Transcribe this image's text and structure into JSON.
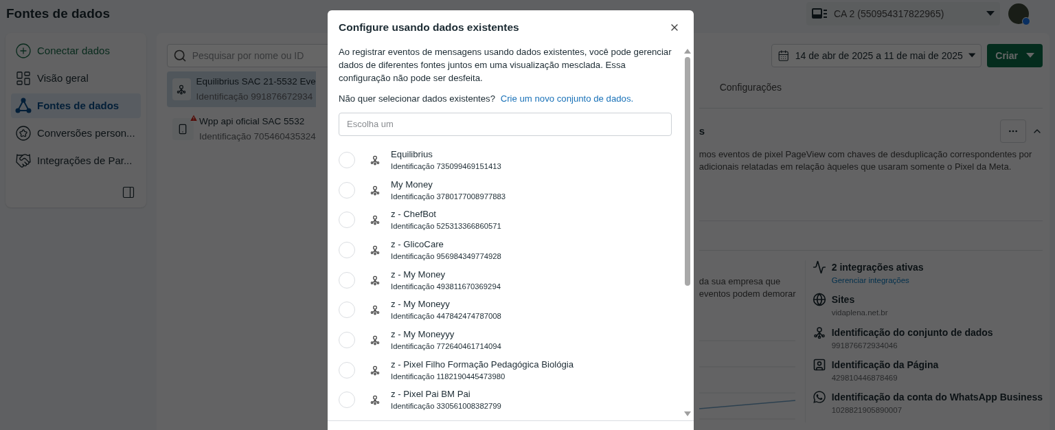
{
  "page": {
    "title": "Fontes de dados"
  },
  "account": {
    "name": "CA 2 (550954317822965)"
  },
  "sidebar": {
    "items": [
      {
        "label": "Conectar dados",
        "kind": "connect",
        "selected": false
      },
      {
        "label": "Visão geral",
        "kind": "overview",
        "selected": false
      },
      {
        "label": "Fontes de dados",
        "kind": "sources",
        "selected": true
      },
      {
        "label": "Conversões person...",
        "kind": "conversions",
        "selected": false
      },
      {
        "label": "Integrações de Par...",
        "kind": "partners",
        "selected": false
      }
    ]
  },
  "sources": {
    "search": {
      "placeholder": "Pesquisar por nome ou ID"
    },
    "items": [
      {
        "name": "Equilibrius SAC 21-5532 Eve",
        "id": "Identificação 991876672934",
        "kind": "dataset",
        "warning": false,
        "selected": true
      },
      {
        "name": "Wpp api oficial SAC 5532",
        "id": "Identificação 705460435324",
        "kind": "phone",
        "warning": true,
        "selected": false
      }
    ]
  },
  "toolbar": {
    "date_range": "14 de abr de 2025 a 11 de mai de 2025",
    "create_button": "Criar"
  },
  "tabs": [
    {
      "label": "Configurações",
      "selected": false
    }
  ],
  "card": {
    "title": "s",
    "description": [
      "mos eventos de pixel PageView com chaves de desduplicação correspondentes por",
      "adicionais relatadas em relação àqueles que usaram somente o Pixel da Meta."
    ]
  },
  "overview": {
    "text": [
      "da sua empresa que",
      "eventos podem demorar"
    ]
  },
  "details": [
    {
      "kind": "activity",
      "title": "2 integrações ativas",
      "value": "Gerenciar integrações",
      "link": true
    },
    {
      "kind": "globe",
      "title": "Sites",
      "value": "vidaplena.net.br",
      "link": false
    },
    {
      "kind": "dataset",
      "title": "Identificação do conjunto de dados",
      "value": "991876672934046",
      "link": false
    },
    {
      "kind": "page",
      "title": "Identificação da Página",
      "value": "429810446878469",
      "link": false
    },
    {
      "kind": "whatsapp",
      "title": "Identificação da conta do WhatsApp Business",
      "value": "1028821905890007",
      "link": false
    }
  ],
  "dialog": {
    "title": "Configure usando dados existentes",
    "description": "Ao registrar eventos de mensagens usando dados existentes, você pode gerenciar dados de diferentes fontes juntos em uma visualização mesclada. Essa configuração não pode ser desfeita.",
    "prompt": "Não quer selecionar dados existentes?",
    "link": "Crie um novo conjunto de dados.",
    "select": {
      "placeholder": "Escolha um"
    },
    "options": [
      {
        "name": "Equilibrius",
        "id": "Identificação 735099469151413",
        "selected": false
      },
      {
        "name": "My Money",
        "id": "Identificação 3780177008977883",
        "selected": false
      },
      {
        "name": "z - ChefBot",
        "id": "Identificação 525313366860571",
        "selected": false
      },
      {
        "name": "z - GlicoCare",
        "id": "Identificação 956984349774928",
        "selected": false
      },
      {
        "name": "z - My Money",
        "id": "Identificação 493811670369294",
        "selected": false
      },
      {
        "name": "z - My Moneyy",
        "id": "Identificação 447842474787008",
        "selected": false
      },
      {
        "name": "z - My Moneyyy",
        "id": "Identificação 772640461714094",
        "selected": false
      },
      {
        "name": "z - Pixel Filho Formação Pedagógica Biológia",
        "id": "Identificação 1182190445473980",
        "selected": false
      },
      {
        "name": "z - Pixel Pai BM Pai",
        "id": "Identificação 330561008382799",
        "selected": false
      }
    ]
  }
}
